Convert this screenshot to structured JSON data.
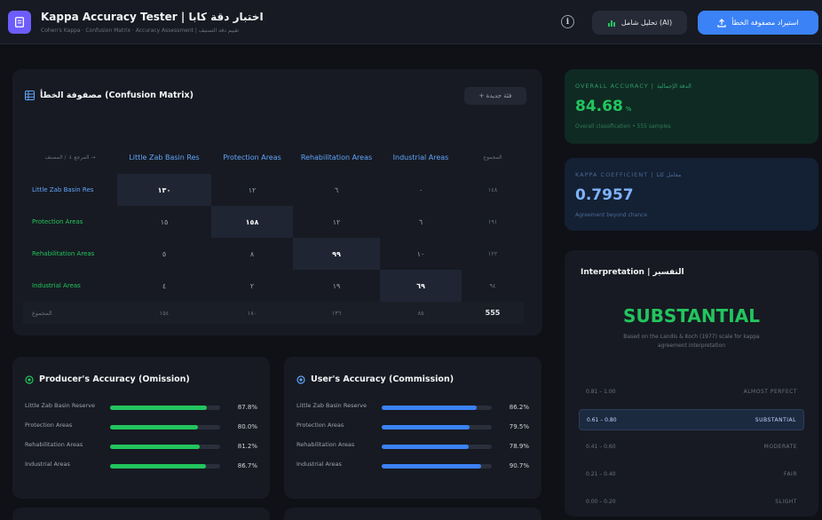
{
  "header": {
    "title": "Kappa Accuracy Tester | اختبار دقة كابا",
    "subtitle": "Cohen's Kappa · Confusion Matrix · Accuracy Assessment | تقييم دقة التصنيف",
    "analyze_label": "تحليل شامل (AI)",
    "import_label": "استيراد مصفوفة الخطأ",
    "info_label": "i"
  },
  "matrix": {
    "title": "مصفوفة الخطأ (Confusion Matrix)",
    "add_label": "+ فئة جديدة",
    "corner_label": "المرجع ↓ / المصنف →",
    "total_label": "المجموع",
    "columns": [
      "Little Zab Basin Res",
      "Protection Areas",
      "Rehabilitation Areas",
      "Industrial Areas"
    ],
    "rows": [
      {
        "label": "Little Zab Basin Res",
        "cells": [
          "١٣٠",
          "١٢",
          "٦",
          "٠"
        ],
        "total": "١٤٨"
      },
      {
        "label": "Protection Areas",
        "cells": [
          "١٥",
          "١٥٨",
          "١٢",
          "٦"
        ],
        "total": "١٩١"
      },
      {
        "label": "Rehabilitation Areas",
        "cells": [
          "٥",
          "٨",
          "٩٩",
          "١٠"
        ],
        "total": "١٢٢"
      },
      {
        "label": "Industrial Areas",
        "cells": [
          "٤",
          "٢",
          "١٩",
          "٦٩"
        ],
        "total": "٩٤"
      }
    ],
    "col_totals_label": "المجموع",
    "col_totals": [
      "١٥٤",
      "١٨٠",
      "١٣٦",
      "٨٥"
    ],
    "grand_total": "555"
  },
  "producers": {
    "title": "Producer's Accuracy (Omission)",
    "items": [
      {
        "label": "Little Zab Basin Reserve",
        "value": "87.8%",
        "pct": 87.8
      },
      {
        "label": "Protection Areas",
        "value": "80.0%",
        "pct": 80.0
      },
      {
        "label": "Rehabilitation Areas",
        "value": "81.2%",
        "pct": 81.2
      },
      {
        "label": "Industrial Areas",
        "value": "86.7%",
        "pct": 86.7
      }
    ],
    "color": "#22c55e"
  },
  "users": {
    "title": "User's Accuracy (Commission)",
    "items": [
      {
        "label": "Little Zab Basin Reserve",
        "value": "86.2%",
        "pct": 86.2
      },
      {
        "label": "Protection Areas",
        "value": "79.5%",
        "pct": 79.5
      },
      {
        "label": "Rehabilitation Areas",
        "value": "78.9%",
        "pct": 78.9
      },
      {
        "label": "Industrial Areas",
        "value": "90.7%",
        "pct": 90.7
      }
    ],
    "color": "#3b82f6"
  },
  "overall": {
    "label": "OVERALL ACCURACY | الدقة الإجمالية",
    "value": "84.68",
    "unit": "%",
    "note": "Overall classification • 555 samples",
    "accent": "#22c55e"
  },
  "kappa": {
    "label": "KAPPA COEFFICIENT | معامل كابا",
    "value": "0.7957",
    "note": "Agreement beyond chance",
    "accent": "#60a5fa"
  },
  "interpretation": {
    "title": "Interpretation | التفسير",
    "level": "SUBSTANTIAL",
    "description": "Based on the Landis & Koch (1977) scale for kappa agreement interpretation",
    "scale": [
      {
        "range": "0.81 – 1.00",
        "level": "ALMOST PERFECT",
        "active": false
      },
      {
        "range": "0.61 – 0.80",
        "level": "SUBSTANTIAL",
        "active": true
      },
      {
        "range": "0.41 – 0.60",
        "level": "MODERATE",
        "active": false
      },
      {
        "range": "0.21 – 0.40",
        "level": "FAIR",
        "active": false
      },
      {
        "range": "0.00 – 0.20",
        "level": "SLIGHT",
        "active": false
      }
    ]
  }
}
